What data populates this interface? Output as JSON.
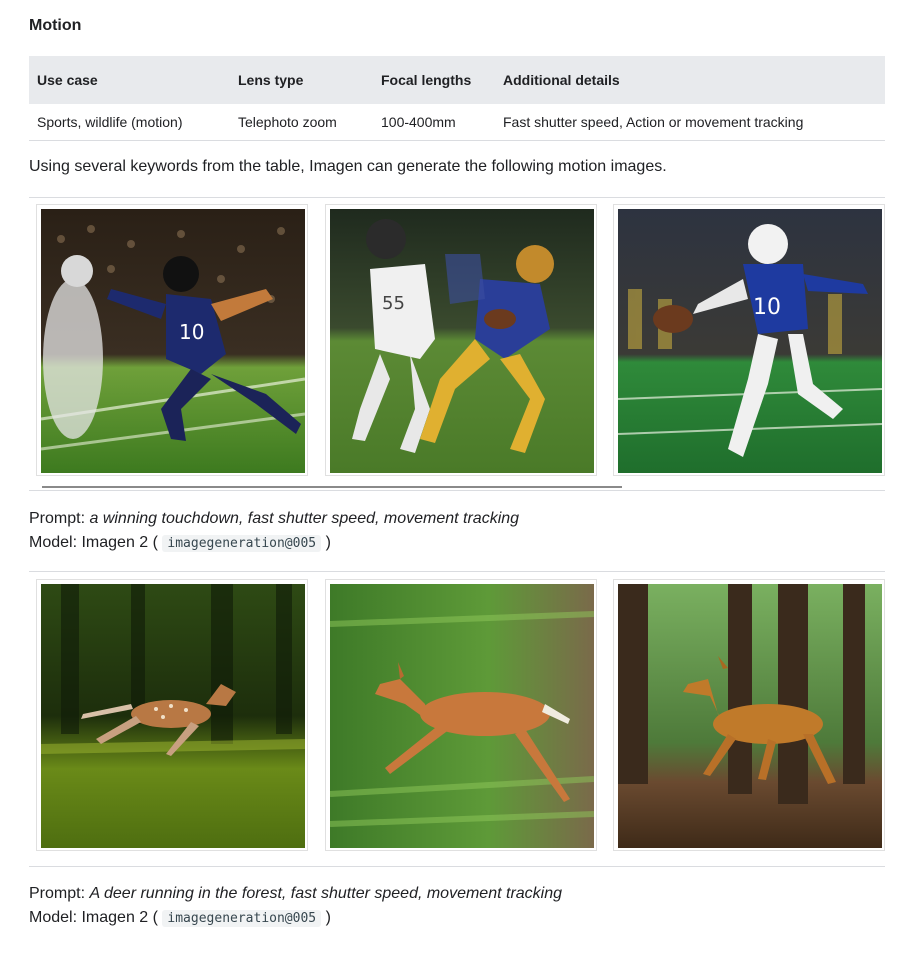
{
  "section": {
    "title": "Motion"
  },
  "table": {
    "headers": [
      "Use case",
      "Lens type",
      "Focal lengths",
      "Additional details"
    ],
    "rows": [
      [
        "Sports, wildlife (motion)",
        "Telephoto zoom",
        "100-400mm",
        "Fast shutter speed, Action or movement tracking"
      ]
    ]
  },
  "intro_text": "Using several keywords from the table, Imagen can generate the following motion images.",
  "galleries": [
    {
      "images": [
        {
          "icon": "football-player-image",
          "jersey": "10"
        },
        {
          "icon": "football-runners-image",
          "jersey": "55"
        },
        {
          "icon": "football-kicker-image",
          "jersey": "10"
        }
      ],
      "prompt_label": "Prompt:",
      "prompt_text": "a winning touchdown, fast shutter speed, movement tracking",
      "model_label": "Model: Imagen 2 (",
      "model_code": "imagegeneration@005",
      "model_close": ")"
    },
    {
      "images": [
        {
          "icon": "fawn-running-image"
        },
        {
          "icon": "deer-leaping-image"
        },
        {
          "icon": "deer-forest-image"
        }
      ],
      "prompt_label": "Prompt:",
      "prompt_text": "A deer running in the forest, fast shutter speed, movement tracking",
      "model_label": "Model: Imagen 2 (",
      "model_code": "imagegeneration@005",
      "model_close": ")"
    }
  ],
  "colors": {
    "table_header_bg": "#e8eaed",
    "divider": "#dadce0",
    "code_bg": "#f1f3f4"
  }
}
